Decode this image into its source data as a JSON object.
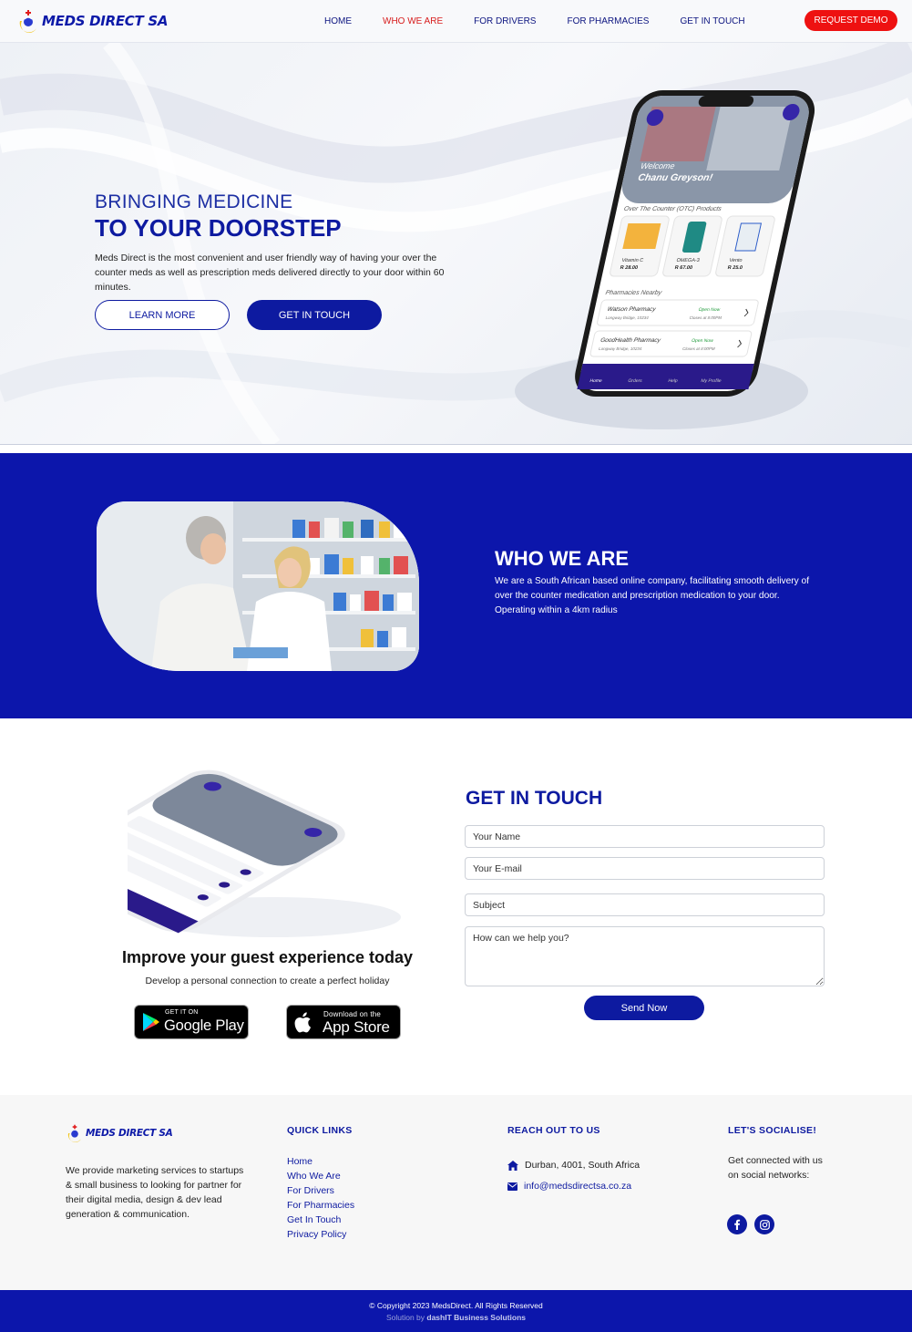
{
  "brand": {
    "name": "MEDS DIRECT SA"
  },
  "nav": {
    "items": [
      {
        "label": "HOME"
      },
      {
        "label": "WHO WE ARE"
      },
      {
        "label": "FOR DRIVERS"
      },
      {
        "label": "FOR PHARMACIES"
      },
      {
        "label": "GET IN TOUCH"
      }
    ],
    "active_item": "WHO WE ARE",
    "cta_label": "REQUEST DEMO"
  },
  "hero": {
    "subtitle": "BRINGING MEDICINE",
    "title": "TO YOUR DOORSTEP",
    "text": "Meds Direct is the most convenient and user friendly way of having your over the counter meds as well as prescription meds delivered directly to your door within 60 minutes.",
    "learn_more_label": "LEARN MORE",
    "get_in_touch_label": "GET IN TOUCH",
    "phone": {
      "welcome": "Welcome",
      "user": "Chanu Greyson!",
      "otc_heading": "Over The Counter (OTC) Products",
      "products": [
        {
          "name": "Vitamin C",
          "price": "R 28.00"
        },
        {
          "name": "OMEGA-3",
          "price": "R 67.00"
        },
        {
          "name": "Vento",
          "price": "R 25.0"
        }
      ],
      "pharmacies_heading": "Pharmacies Nearby",
      "pharmacies": [
        {
          "name": "Watson Pharmacy",
          "address": "Longway Bridge, 10234",
          "status": "Open Now",
          "closes": "Closes at 8:00PM"
        },
        {
          "name": "GoodHealth Pharmacy",
          "address": "Longway Bridge, 10234",
          "status": "Open Now",
          "closes": "Closes at 8:00PM"
        }
      ],
      "tabs": [
        "Home",
        "Orders",
        "Help",
        "My Profile"
      ]
    }
  },
  "who": {
    "title": "WHO WE ARE",
    "text": "We are a South African based online company, facilitating smooth delivery of over the counter medication and prescription medication to your door. Operating within a 4km radius"
  },
  "app_promo": {
    "title": "Improve your guest experience today",
    "text": "Develop a personal connection to create a perfect holiday",
    "google": {
      "small": "GET IT ON",
      "big": "Google Play"
    },
    "apple": {
      "small": "Download on the",
      "big": "App Store"
    }
  },
  "contact_form": {
    "title": "GET IN TOUCH",
    "name_placeholder": "Your Name",
    "email_placeholder": "Your E-mail",
    "subject_placeholder": "Subject",
    "message_placeholder": "How can we help you?",
    "send_label": "Send Now"
  },
  "footer": {
    "about": "We provide marketing services to startups & small business to looking for partner for their digital media, design & dev lead generation & communication.",
    "quick_links_title": "QUICK LINKS",
    "quick_links": [
      "Home",
      "Who We Are",
      "For Drivers",
      "For Pharmacies",
      "Get In Touch",
      "Privacy Policy"
    ],
    "reach_title": "REACH OUT TO US",
    "address": "Durban, 4001, South Africa",
    "email": "info@medsdirectsa.co.za",
    "social_title": "LET'S SOCIALISE!",
    "social_text": "Get connected with us on social networks:",
    "social_icons": [
      "facebook-icon",
      "instagram-icon"
    ],
    "copyright": "© Copyright 2023 MedsDirect. All Rights Reserved",
    "credit_prefix": "Solution by",
    "credit_company": "dashIT Business Solutions"
  },
  "colors": {
    "primary": "#0d1aa0",
    "section_blue": "#0c16ab",
    "accent_red": "#ee1111",
    "footer_bg": "#f7f7f7"
  }
}
